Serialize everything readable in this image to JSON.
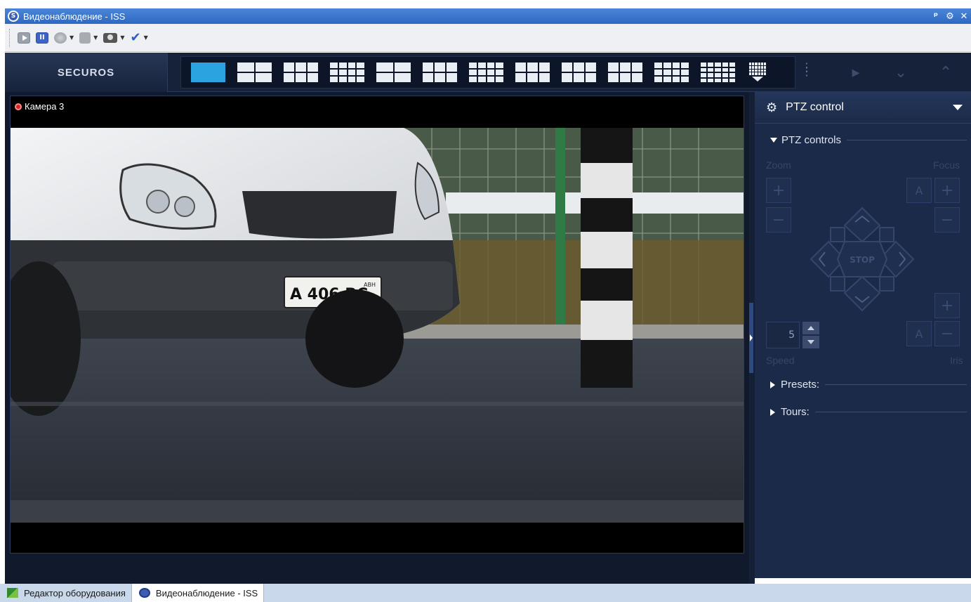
{
  "window": {
    "title": "Видеонаблюдение - ISS",
    "app_logo": "S",
    "controls": {
      "pin": "ᵖ",
      "settings": "⚙",
      "close": "✕"
    }
  },
  "toolbar": {
    "items": [
      {
        "name": "play",
        "icon": "play-icon"
      },
      {
        "name": "pause",
        "icon": "pause-icon",
        "glyph": "II"
      },
      {
        "name": "record",
        "icon": "record-icon"
      },
      {
        "name": "stop",
        "icon": "stop-icon"
      },
      {
        "name": "snapshot",
        "icon": "camera-icon"
      },
      {
        "name": "check",
        "icon": "checkmark-icon",
        "glyph": "✔"
      }
    ]
  },
  "nav": {
    "brand": "SECUROS",
    "nav_icons": [
      "play-next-icon",
      "chevron-down-icon",
      "chevron-up-icon"
    ],
    "nav_glyphs": {
      "next": "▸",
      "down": "⌄",
      "up": "⌃"
    }
  },
  "camera": {
    "label": "Камера 3",
    "plate_text": "А 406 ВС",
    "plate_region": "АВН"
  },
  "ptz": {
    "panel_title": "PTZ control",
    "section_controls": "PTZ controls",
    "zoom_label": "Zoom",
    "focus_label": "Focus",
    "speed_label": "Speed",
    "iris_label": "Iris",
    "stop_label": "STOP",
    "speed_value": "5",
    "plus": "+",
    "minus": "−",
    "auto": "A",
    "section_presets": "Presets:",
    "section_tours": "Tours:"
  },
  "taskbar": {
    "items": [
      {
        "label": "Редактор оборудования",
        "icon": "flag-icon",
        "active": false
      },
      {
        "label": "Видеонаблюдение - ISS",
        "icon": "securos-logo-icon",
        "active": true
      }
    ]
  },
  "colors": {
    "titlebar": "#3573cc",
    "nav_bg": "#16223a",
    "panel_bg": "#1b2a48",
    "layout_selected": "#2aa3e0",
    "rec_dot": "#d42323"
  }
}
